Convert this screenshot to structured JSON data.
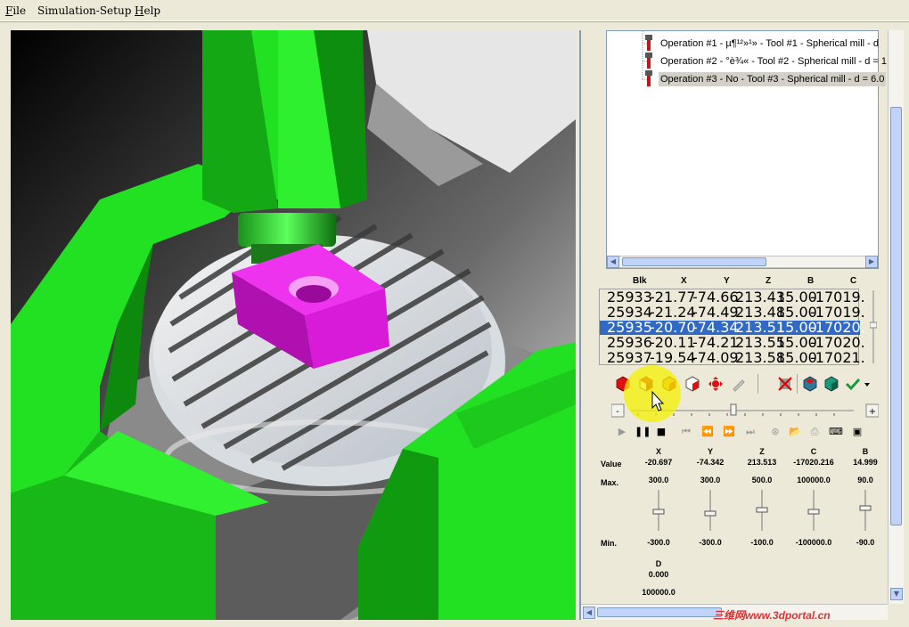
{
  "menu": {
    "file": "File",
    "file_key": "F",
    "file_rest": "ile",
    "sim": "Simulation-Setup",
    "help": "Help",
    "help_key": "H",
    "help_rest": "elp"
  },
  "operations": [
    {
      "label": "Operation #1 - µ¶¹²»¹» - Tool #1 - Spherical mill - d"
    },
    {
      "label": "Operation #2 - °è¾« - Tool #2 - Spherical mill - d = 1"
    },
    {
      "label": "Operation #3 - No - Tool #3 - Spherical mill - d = 6.0"
    }
  ],
  "grid": {
    "headers": [
      "Blk",
      "X",
      "Y",
      "Z",
      "B",
      "C"
    ],
    "rows": [
      [
        "25933",
        "-21.77",
        "-74.66",
        "213.43",
        "15.00",
        "-17019."
      ],
      [
        "25934",
        "-21.24",
        "-74.49",
        "213.48",
        "15.00",
        "-17019."
      ],
      [
        "25935",
        "-20.70",
        "-74.34",
        "213.51",
        "15.00",
        "-17020."
      ],
      [
        "25936",
        "-20.11",
        "-74.21",
        "213.55",
        "15.00",
        "-17020."
      ],
      [
        "25937",
        "-19.54",
        "-74.09",
        "213.58",
        "15.00",
        "-17021."
      ]
    ],
    "selected_row": 2
  },
  "axes": {
    "labels": {
      "value": "Value",
      "max": "Max.",
      "min": "Min."
    },
    "items": [
      {
        "name": "X",
        "value": "-20.697",
        "max": "300.0",
        "min": "-300.0"
      },
      {
        "name": "Y",
        "value": "-74.342",
        "max": "300.0",
        "min": "-300.0"
      },
      {
        "name": "Z",
        "value": "213.513",
        "max": "500.0",
        "min": "-100.0"
      },
      {
        "name": "C",
        "value": "-17020.216",
        "max": "100000.0",
        "min": "-100000.0"
      },
      {
        "name": "B",
        "value": "14.999",
        "max": "90.0",
        "min": "-90.0"
      }
    ],
    "d": {
      "name": "D",
      "value": "0.000",
      "max": "100000.0"
    }
  },
  "watermark": "三维网www.3dportal.cn",
  "colors": {
    "machine_green": "#22e022",
    "workpiece": "#d81bd8",
    "selection": "#316ac5"
  },
  "icons": [
    "red-cube-icon",
    "half-red-cube-icon",
    "orange-cube-icon",
    "white-cube-icon",
    "move-arrows-icon",
    "pen-icon",
    "no-collision-icon",
    "stack-icon",
    "cube-icon",
    "check-icon",
    "dropdown-arrow-icon"
  ]
}
